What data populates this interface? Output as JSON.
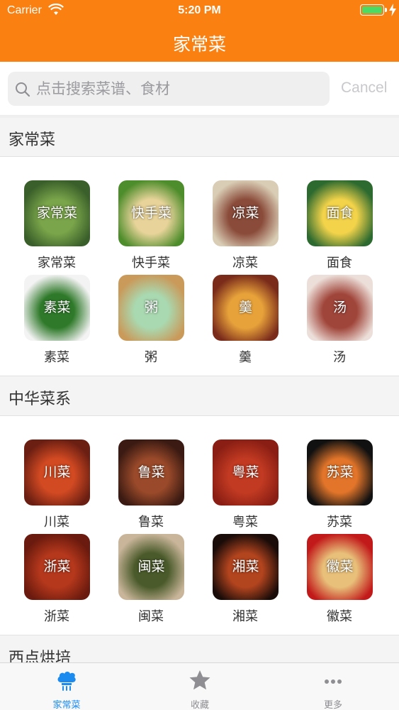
{
  "status_bar": {
    "carrier": "Carrier",
    "time": "5:20 PM"
  },
  "nav": {
    "title": "家常菜"
  },
  "search": {
    "placeholder": "点击搜索菜谱、食材",
    "value": "",
    "cancel_label": "Cancel"
  },
  "sections": [
    {
      "title": "家常菜",
      "items": [
        {
          "label": "家常菜",
          "overlay": "家常菜",
          "colors": [
            "#3b5f2a",
            "#7aa54a"
          ]
        },
        {
          "label": "快手菜",
          "overlay": "快手菜",
          "colors": [
            "#4e8d2c",
            "#e8d49a"
          ]
        },
        {
          "label": "凉菜",
          "overlay": "凉菜",
          "colors": [
            "#d9cdb5",
            "#8a4b3a"
          ]
        },
        {
          "label": "面食",
          "overlay": "面食",
          "colors": [
            "#2d6a2f",
            "#f2d34a"
          ]
        },
        {
          "label": "素菜",
          "overlay": "素菜",
          "colors": [
            "#f3f3f3",
            "#2f7a2a"
          ]
        },
        {
          "label": "粥",
          "overlay": "粥",
          "colors": [
            "#c99a5a",
            "#a9d9b0"
          ]
        },
        {
          "label": "羹",
          "overlay": "羹",
          "colors": [
            "#7a2b1a",
            "#e8a23a"
          ]
        },
        {
          "label": "汤",
          "overlay": "汤",
          "colors": [
            "#ecdfd9",
            "#a0453a"
          ]
        }
      ]
    },
    {
      "title": "中华菜系",
      "items": [
        {
          "label": "川菜",
          "overlay": "川菜",
          "colors": [
            "#6b1f12",
            "#d24a22"
          ]
        },
        {
          "label": "鲁菜",
          "overlay": "鲁菜",
          "colors": [
            "#3a1a12",
            "#9a4a2a"
          ]
        },
        {
          "label": "粤菜",
          "overlay": "粤菜",
          "colors": [
            "#8a1e14",
            "#c23a22"
          ]
        },
        {
          "label": "苏菜",
          "overlay": "苏菜",
          "colors": [
            "#111111",
            "#e2752a"
          ]
        },
        {
          "label": "浙菜",
          "overlay": "浙菜",
          "colors": [
            "#6a1a0e",
            "#b5381c"
          ]
        },
        {
          "label": "闽菜",
          "overlay": "闽菜",
          "colors": [
            "#c9b59a",
            "#4a5a2a"
          ]
        },
        {
          "label": "湘菜",
          "overlay": "湘菜",
          "colors": [
            "#1a0c08",
            "#b2441e"
          ]
        },
        {
          "label": "徽菜",
          "overlay": "徽菜",
          "colors": [
            "#c21a1a",
            "#e8c07a"
          ]
        }
      ]
    },
    {
      "title": "西点烘培",
      "items": []
    }
  ],
  "tabbar": {
    "items": [
      {
        "label": "家常菜",
        "icon": "chef-hat-icon",
        "active": true
      },
      {
        "label": "收藏",
        "icon": "star-icon",
        "active": false
      },
      {
        "label": "更多",
        "icon": "more-dots-icon",
        "active": false
      }
    ]
  },
  "colors": {
    "accent": "#f98011",
    "tab_active": "#1c8bf0",
    "tab_inactive": "#8e8e93"
  }
}
